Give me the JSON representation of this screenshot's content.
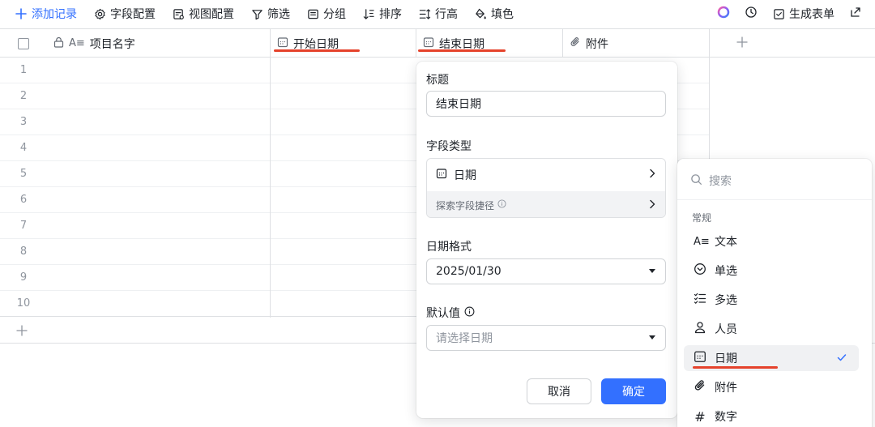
{
  "toolbar": {
    "add_record": "添加记录",
    "field_config": "字段配置",
    "view_config": "视图配置",
    "filter": "筛选",
    "group": "分组",
    "sort": "排序",
    "row_height": "行高",
    "fill": "填色",
    "generate_form": "生成表单"
  },
  "columns": {
    "name": "项目名字",
    "start_date": "开始日期",
    "end_date": "结束日期",
    "attachment": "附件"
  },
  "rows": [
    "1",
    "2",
    "3",
    "4",
    "5",
    "6",
    "7",
    "8",
    "9",
    "10"
  ],
  "field_panel": {
    "title_label": "标题",
    "title_value": "结束日期",
    "type_label": "字段类型",
    "type_value": "日期",
    "explore_shortcut": "探索字段捷径",
    "date_format_label": "日期格式",
    "date_format_value": "2025/01/30",
    "default_label": "默认值",
    "default_placeholder": "请选择日期",
    "cancel": "取消",
    "confirm": "确定"
  },
  "type_menu": {
    "search_placeholder": "搜索",
    "group_label": "常规",
    "items": [
      {
        "label": "文本",
        "icon": "text-icon"
      },
      {
        "label": "单选",
        "icon": "single-select-icon"
      },
      {
        "label": "多选",
        "icon": "multi-select-icon"
      },
      {
        "label": "人员",
        "icon": "person-icon"
      },
      {
        "label": "日期",
        "icon": "date-icon",
        "selected": true
      },
      {
        "label": "附件",
        "icon": "attachment-icon"
      },
      {
        "label": "数字",
        "icon": "number-icon"
      }
    ]
  },
  "colors": {
    "accent": "#3370ff",
    "highlight_underline": "#e5422b"
  }
}
